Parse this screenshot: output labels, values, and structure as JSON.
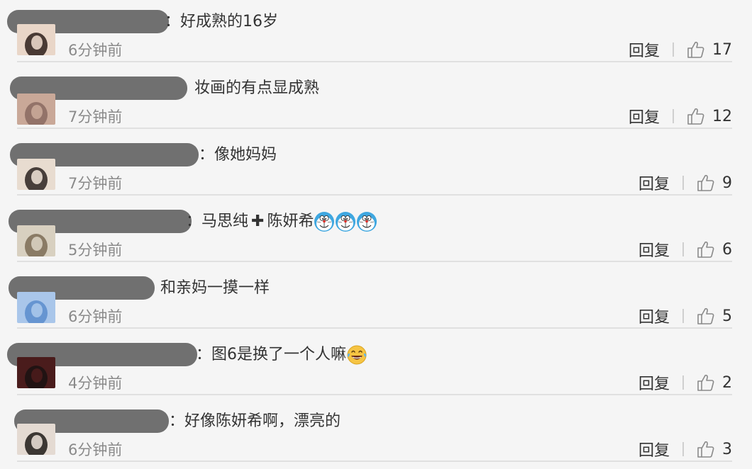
{
  "comments": [
    {
      "text_prefix": "：",
      "text": "好成熟的16岁",
      "time": "6分钟前",
      "reply_label": "回复",
      "likes": "17",
      "avatar_colors": [
        "#2d1f1a",
        "#e9d6c8"
      ],
      "emoji_count": 0
    },
    {
      "text_prefix": "",
      "text": "妆画的有点显成熟",
      "time": "7分钟前",
      "reply_label": "回复",
      "likes": "12",
      "avatar_colors": [
        "#8a6a60",
        "#c9a898"
      ],
      "emoji_count": 0
    },
    {
      "text_prefix": "：",
      "text": "像她妈妈",
      "time": "7分钟前",
      "reply_label": "回复",
      "likes": "9",
      "avatar_colors": [
        "#2a2220",
        "#e8dcd0"
      ],
      "emoji_count": 0
    },
    {
      "text_prefix": "：",
      "text": "马思纯",
      "plus": "✚",
      "text_after": "陈妍希",
      "time": "5分钟前",
      "reply_label": "回复",
      "likes": "6",
      "avatar_colors": [
        "#7d6c55",
        "#d8d0c0"
      ],
      "emoji": "doraemon-face",
      "emoji_count": 3
    },
    {
      "text_prefix": "",
      "text": "和亲妈一摸一样",
      "time": "6分钟前",
      "reply_label": "回复",
      "likes": "5",
      "avatar_colors": [
        "#5b8ccc",
        "#a9c6ea"
      ],
      "emoji_count": 0
    },
    {
      "text_prefix": "：",
      "text": "图6是换了一个人嘛",
      "time": "4分钟前",
      "reply_label": "回复",
      "likes": "2",
      "avatar_colors": [
        "#1a1212",
        "#4a1c1c"
      ],
      "emoji": "laughing-tears-face",
      "emoji_count": 1
    },
    {
      "text_prefix": "：",
      "text": "好像陈妍希啊，漂亮的",
      "time": "6分钟前",
      "reply_label": "回复",
      "likes": "3",
      "avatar_colors": [
        "#1f1a18",
        "#e4dad2"
      ],
      "emoji_count": 0
    }
  ],
  "icons": {
    "like": "thumbs-up-icon"
  }
}
